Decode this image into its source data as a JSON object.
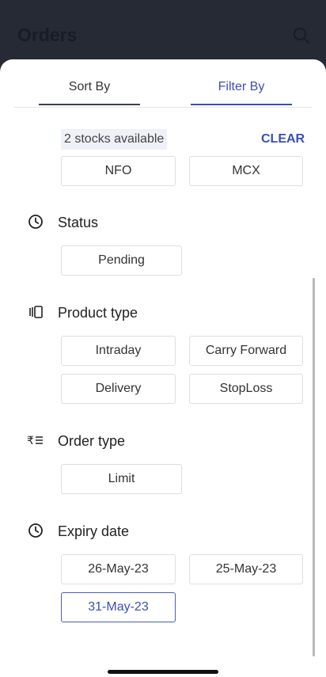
{
  "backdrop": {
    "title": "Orders",
    "search_icon": "search-icon"
  },
  "tabs": {
    "sort_label": "Sort By",
    "filter_label": "Filter By",
    "active": "Filter By"
  },
  "filter": {
    "stocks_available": "2 stocks available",
    "clear_label": "CLEAR",
    "exchanges": [
      "NFO",
      "MCX"
    ],
    "status": {
      "title": "Status",
      "icon": "clock-icon",
      "options": [
        "Pending"
      ]
    },
    "product_type": {
      "title": "Product type",
      "icon": "product-type-icon",
      "options": [
        "Intraday",
        "Carry Forward",
        "Delivery",
        "StopLoss"
      ]
    },
    "order_type": {
      "title": "Order type",
      "icon": "rupee-list-icon",
      "options": [
        "Limit"
      ]
    },
    "expiry_date": {
      "title": "Expiry date",
      "icon": "clock-icon",
      "options": [
        "26-May-23",
        "25-May-23",
        "31-May-23"
      ],
      "selected": "31-May-23"
    }
  },
  "colors": {
    "accent": "#3c4fb0",
    "backdrop": "#262a35",
    "chip_border": "#dedede"
  }
}
